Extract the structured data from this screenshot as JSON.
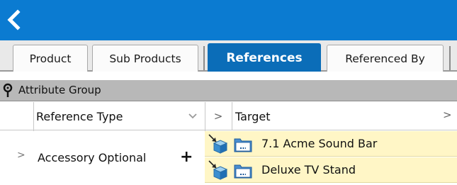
{
  "tabs": [
    {
      "label": "Product",
      "active": false
    },
    {
      "label": "Sub Products",
      "active": false
    },
    {
      "label": "References",
      "active": true
    },
    {
      "label": "Referenced By",
      "active": false
    }
  ],
  "grid": {
    "group_label": "Attribute Group",
    "columns": {
      "reference_type": "Reference Type",
      "target": "Target"
    },
    "rows": [
      {
        "reference_type": "Accessory Optional",
        "add_symbol": "+",
        "expand_symbol": ">",
        "targets": [
          "7.1 Acme Sound Bar",
          "Deluxe TV Stand"
        ]
      }
    ],
    "header_chevron": ">",
    "header_target_chevron": ">"
  },
  "colors": {
    "accent": "#0b7bd1",
    "active_tab": "#0b6db8",
    "group_row": "#b8b8b8",
    "target_highlight": "#fff6c6"
  },
  "icons": [
    "back-chevron-icon",
    "pin-icon",
    "filter-dropdown-icon",
    "reference-link-icon",
    "product-folder-icon",
    "add-icon",
    "expand-icon"
  ]
}
